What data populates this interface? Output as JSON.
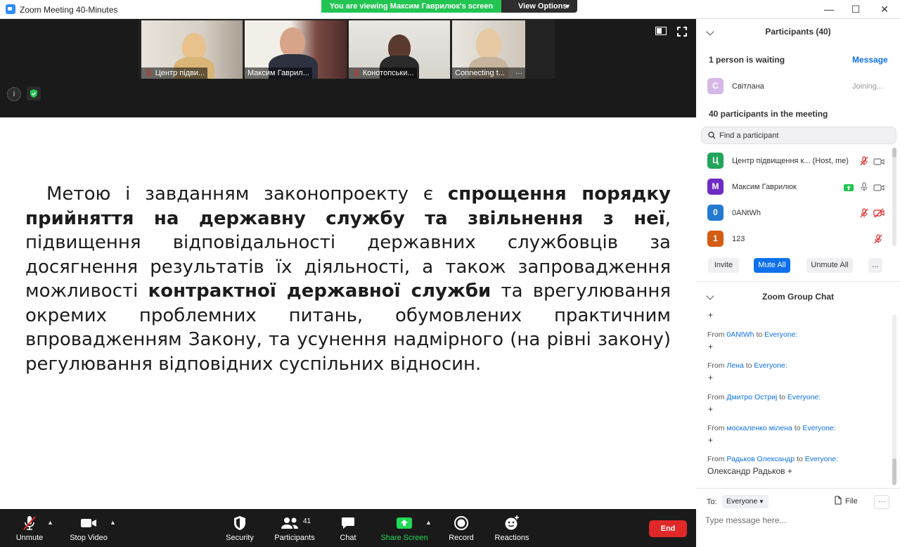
{
  "window": {
    "title": "Zoom Meeting 40-Minutes",
    "viewing_banner": "You are viewing Максим Гаврилюк's screen",
    "view_options": "View Options",
    "minimize": "—",
    "maximize": "☐",
    "close": "✕"
  },
  "video_strip": {
    "tiles": [
      {
        "name": "Центр підви..."
      },
      {
        "name": "Максим Гаврил..."
      },
      {
        "name": "Конотопськи..."
      },
      {
        "name": "Connecting t..."
      }
    ],
    "more": "···",
    "info": "i"
  },
  "slide": {
    "p1": "Метою і завданням законопроекту є ",
    "b1": "спрощення порядку прийняття на державну службу та звільнення з неї",
    "p2": ", підвищення відповідальності державних службовців за досягнення результатів їх діяльності, а також запровадження можливості ",
    "b2": "контрактної державної служби",
    "p3": " та врегулювання окремих проблемних питань, обумовлених практичним впровадженням Закону, та усунення надмірного (на рівні закону) регулювання відповідних суспільних відносин."
  },
  "toolbar": {
    "unmute": "Unmute",
    "stop_video": "Stop Video",
    "security": "Security",
    "participants": "Participants",
    "participants_count": "41",
    "chat": "Chat",
    "share_screen": "Share Screen",
    "record": "Record",
    "reactions": "Reactions",
    "end": "End",
    "colors": {
      "share": "#23d959",
      "end": "#e02828"
    }
  },
  "participants_panel": {
    "title": "Participants (40)",
    "waiting_label": "1 person is waiting",
    "message_label": "Message",
    "waiting": {
      "initial": "С",
      "name": "Світлана",
      "status": "Joining...",
      "color": "#d2b6e3"
    },
    "in_meeting_label": "40 participants in the meeting",
    "search_placeholder": "Find a participant",
    "participants": [
      {
        "initial": "Ц",
        "name": "Центр підвищення к...",
        "role": "(Host, me)",
        "color": "#21a55b"
      },
      {
        "initial": "М",
        "name": "Максим Гаврилюк",
        "role": "",
        "color": "#6f2bc4"
      },
      {
        "initial": "0",
        "name": "0ANtWh",
        "role": "",
        "color": "#2479d0"
      },
      {
        "initial": "1",
        "name": "123",
        "role": "",
        "color": "#d45b12"
      }
    ],
    "invite": "Invite",
    "mute_all": "Mute All",
    "unmute_all": "Unmute All",
    "more": "..."
  },
  "chat_panel": {
    "title": "Zoom Group Chat",
    "from": "From",
    "to_word": "to",
    "everyone": "Everyone:",
    "messages": [
      {
        "text": "+"
      },
      {
        "sender": "0ANtWh",
        "text": "+"
      },
      {
        "sender": "Лена",
        "text": "+"
      },
      {
        "sender": "Дмитро Остриј",
        "text": "+"
      },
      {
        "sender": "москаленко мілена",
        "text": "+"
      },
      {
        "sender": "Радьков Олександр",
        "text": "Олександр Радьков +"
      }
    ],
    "to_label": "To:",
    "to_value": "Everyone",
    "file": "File",
    "more": "···",
    "input_placeholder": "Type message here..."
  }
}
